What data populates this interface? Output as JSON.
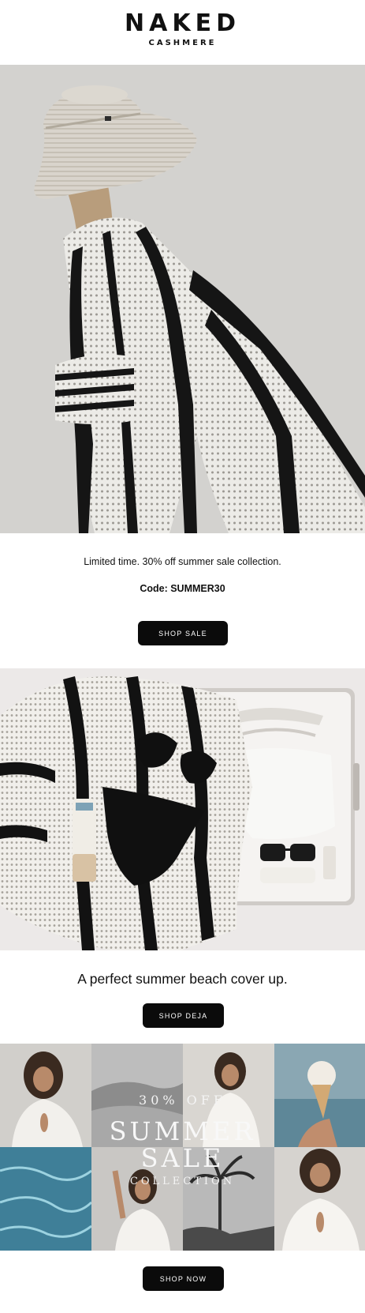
{
  "brand": {
    "name": "NAKED",
    "sub": "CASHMERE"
  },
  "promo": {
    "line1": "Limited time. 30% off summer sale collection.",
    "code": "Code: SUMMER30",
    "cta": "SHOP SALE"
  },
  "feature": {
    "tagline": "A perfect summer beach cover up.",
    "cta": "SHOP DEJA"
  },
  "collage": {
    "overlay_percent": "30% OFF",
    "overlay_summer": "SUMMER",
    "overlay_sale": "SALE",
    "overlay_collection": "COLLECTION",
    "cta": "SHOP NOW"
  },
  "colors": {
    "button_bg": "#0b0b0b",
    "button_text": "#ffffff",
    "text": "#111111",
    "background": "#ffffff"
  }
}
